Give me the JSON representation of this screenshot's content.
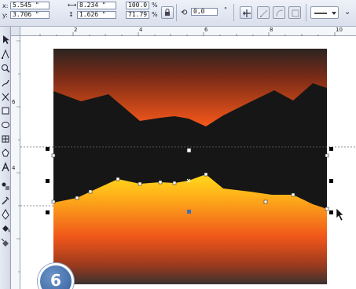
{
  "propbar": {
    "x_label": "x:",
    "x_value": "5.545 \"",
    "y_label": "y:",
    "y_value": "3.706 \"",
    "w_value": "8.234 \"",
    "h_value": "1.626 \"",
    "scale_x": "100.0",
    "scale_y": "71.79",
    "scale_unit": "%",
    "rotation_value": "0,0",
    "rotation_unit": "°"
  },
  "ruler": {
    "h_ticks": [
      "2",
      "4",
      "6",
      "8",
      "10"
    ],
    "v_ticks": [
      "6",
      "4"
    ]
  },
  "badge": {
    "number": "6"
  },
  "colors": {
    "sky_top": "#2a2a2a",
    "sky_orange": "#f0561a",
    "horizon_yellow": "#ffd21a",
    "mountain": "#1a1a1a",
    "selection_node": "#3a6fc0"
  }
}
